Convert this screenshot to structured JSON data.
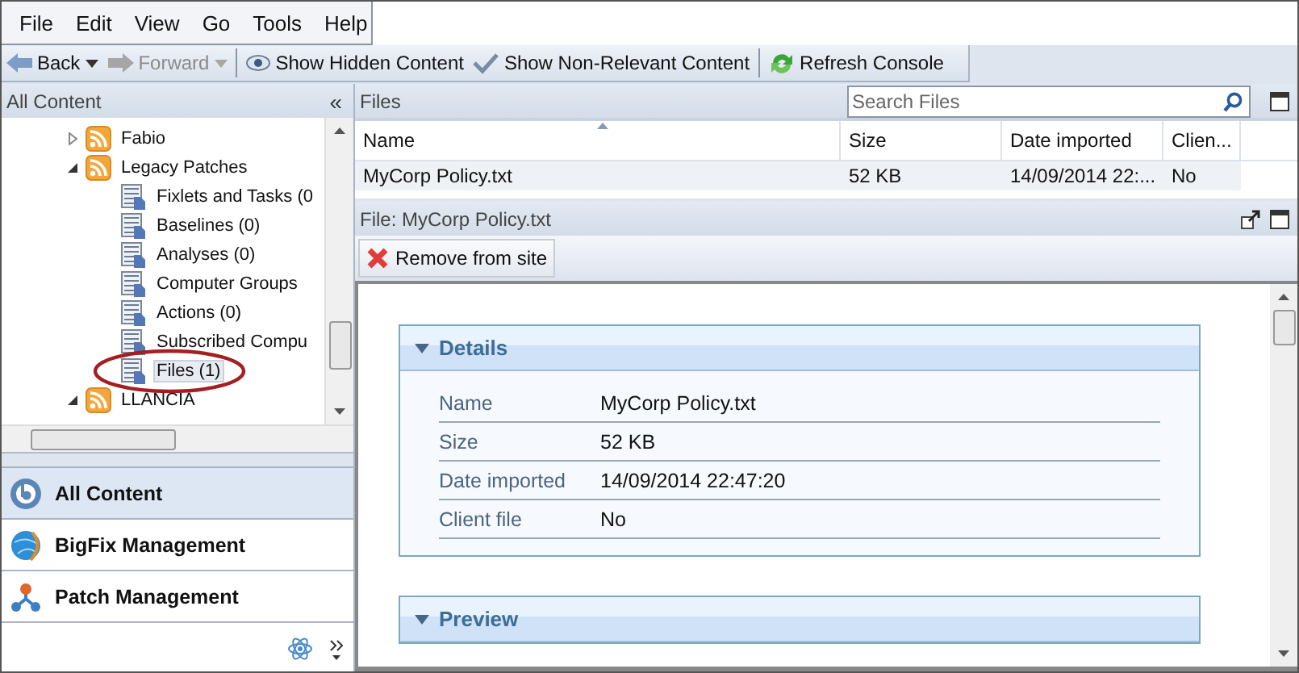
{
  "menu": [
    "File",
    "Edit",
    "View",
    "Go",
    "Tools",
    "Help"
  ],
  "toolbar": [
    {
      "label": "Back",
      "kind": "back",
      "disabled": false,
      "dropdown": true,
      "separator": false
    },
    {
      "label": "Forward",
      "kind": "forward",
      "disabled": true,
      "dropdown": true,
      "separator": false
    },
    {
      "label": "Show Hidden Content",
      "kind": "eye",
      "disabled": false,
      "dropdown": false,
      "separator": true
    },
    {
      "label": "Show Non-Relevant Content",
      "kind": "check",
      "disabled": false,
      "dropdown": false,
      "separator": false
    },
    {
      "label": "Refresh Console",
      "kind": "refresh",
      "disabled": false,
      "dropdown": false,
      "separator": true
    }
  ],
  "sidebar": {
    "title": "All Content",
    "collapse": "«",
    "tree": [
      {
        "label": "Fabio",
        "kind": "site",
        "expanded": false,
        "selected": false
      },
      {
        "label": "Legacy Patches",
        "kind": "site",
        "expanded": true,
        "selected": false,
        "children": [
          {
            "label": "Fixlets and Tasks (0",
            "kind": "list",
            "selected": false
          },
          {
            "label": "Baselines (0)",
            "kind": "list",
            "selected": false
          },
          {
            "label": "Analyses (0)",
            "kind": "list",
            "selected": false
          },
          {
            "label": "Computer Groups",
            "kind": "list",
            "selected": false
          },
          {
            "label": "Actions (0)",
            "kind": "list",
            "selected": false
          },
          {
            "label": "Subscribed Compu",
            "kind": "list",
            "selected": false
          },
          {
            "label": "Files (1)",
            "kind": "list",
            "selected": true,
            "circled": true
          }
        ]
      },
      {
        "label": "LLANCIA",
        "kind": "site",
        "expanded": true,
        "selected": false
      }
    ],
    "nav": [
      {
        "label": "All Content",
        "kind": "all",
        "selected": true
      },
      {
        "label": "BigFix Management",
        "kind": "globe",
        "selected": false
      },
      {
        "label": "Patch Management",
        "kind": "patch",
        "selected": false
      }
    ]
  },
  "files": {
    "title": "Files",
    "search": {
      "placeholder": "Search Files"
    },
    "columns": [
      {
        "label": "Name",
        "sorted": true
      },
      {
        "label": "Size",
        "sorted": false
      },
      {
        "label": "Date imported",
        "sorted": false
      },
      {
        "label": "Clien...",
        "sorted": false
      }
    ],
    "rows": [
      {
        "cells": [
          "MyCorp Policy.txt",
          "52 KB",
          "14/09/2014 22:...",
          "No"
        ],
        "selected": true
      }
    ]
  },
  "detail": {
    "title": "File: MyCorp Policy.txt",
    "action": "Remove from site",
    "sections": [
      {
        "title": "Details",
        "expanded": true,
        "fields": [
          {
            "label": "Name",
            "value": "MyCorp Policy.txt"
          },
          {
            "label": "Size",
            "value": "52 KB"
          },
          {
            "label": "Date imported",
            "value": "14/09/2014 22:47:20"
          },
          {
            "label": "Client file",
            "value": "No"
          }
        ]
      },
      {
        "title": "Preview",
        "expanded": true
      }
    ]
  }
}
